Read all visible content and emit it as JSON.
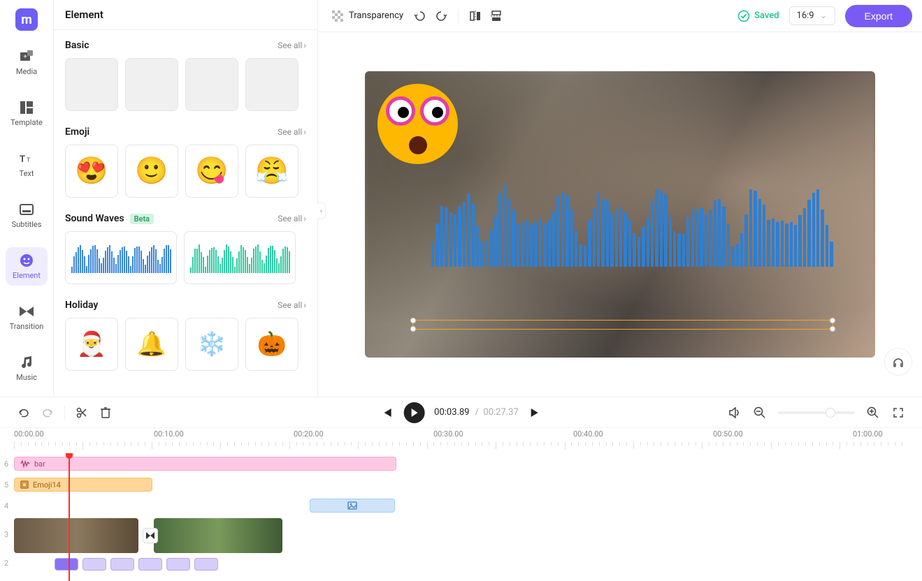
{
  "sidebar": {
    "logo": "m",
    "items": [
      {
        "label": "Media"
      },
      {
        "label": "Template"
      },
      {
        "label": "Text"
      },
      {
        "label": "Subtitles"
      },
      {
        "label": "Element"
      },
      {
        "label": "Transition"
      },
      {
        "label": "Music"
      }
    ]
  },
  "panel": {
    "title": "Element",
    "see_all": "See all",
    "chevron": "›",
    "sections": {
      "basic": {
        "title": "Basic"
      },
      "emoji": {
        "title": "Emoji"
      },
      "soundwaves": {
        "title": "Sound Waves",
        "badge": "Beta"
      },
      "holiday": {
        "title": "Holiday"
      }
    }
  },
  "toolbar": {
    "transparency": "Transparency",
    "saved": "Saved",
    "ratio": "16:9",
    "export": "Export"
  },
  "playback": {
    "current": "00:03.89",
    "sep": "/",
    "total": "00:27.37"
  },
  "ruler": {
    "labels": [
      "00:00.00",
      "00:10.00",
      "00:20.00",
      "00:30.00",
      "00:40.00",
      "00:50.00",
      "01:00.00"
    ]
  },
  "tracks": {
    "row6": {
      "num": "6",
      "label": "bar"
    },
    "row5": {
      "num": "5",
      "label": "Emoji14"
    },
    "row4": {
      "num": "4"
    },
    "row3": {
      "num": "3"
    },
    "row2": {
      "num": "2"
    }
  }
}
